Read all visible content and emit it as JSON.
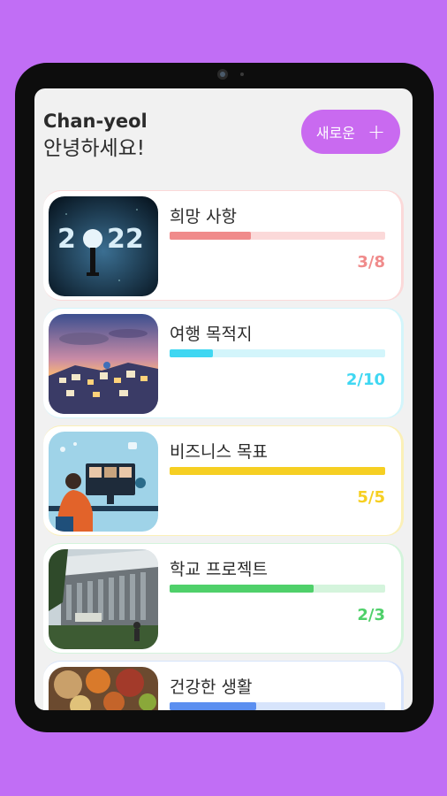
{
  "greeting": {
    "name": "Chan-yeol",
    "hello": "안녕하세요!"
  },
  "new_button": {
    "label": "새로운",
    "icon": "plus-icon"
  },
  "goals": [
    {
      "title": "희망 사항",
      "done": 3,
      "total": 8,
      "count_label": "3/8",
      "color": "#f08b8b",
      "track_color": "#fbd9d9",
      "image": "2022-moon-image"
    },
    {
      "title": "여행 목적지",
      "done": 2,
      "total": 10,
      "count_label": "2/10",
      "color": "#3fd7f2",
      "track_color": "#d3f5fb",
      "image": "santorini-image"
    },
    {
      "title": "비즈니스 목표",
      "done": 5,
      "total": 5,
      "count_label": "5/5",
      "color": "#f6cf22",
      "track_color": "#fbf0b7",
      "image": "video-meeting-image"
    },
    {
      "title": "학교 프로젝트",
      "done": 2,
      "total": 3,
      "count_label": "2/3",
      "color": "#4fd06a",
      "track_color": "#d4f4dc",
      "image": "school-building-image"
    },
    {
      "title": "건강한 생활",
      "done": 2,
      "total": 5,
      "count_label": "",
      "color": "#5b8ff0",
      "track_color": "#d7e4fb",
      "image": "healthy-food-image"
    }
  ]
}
